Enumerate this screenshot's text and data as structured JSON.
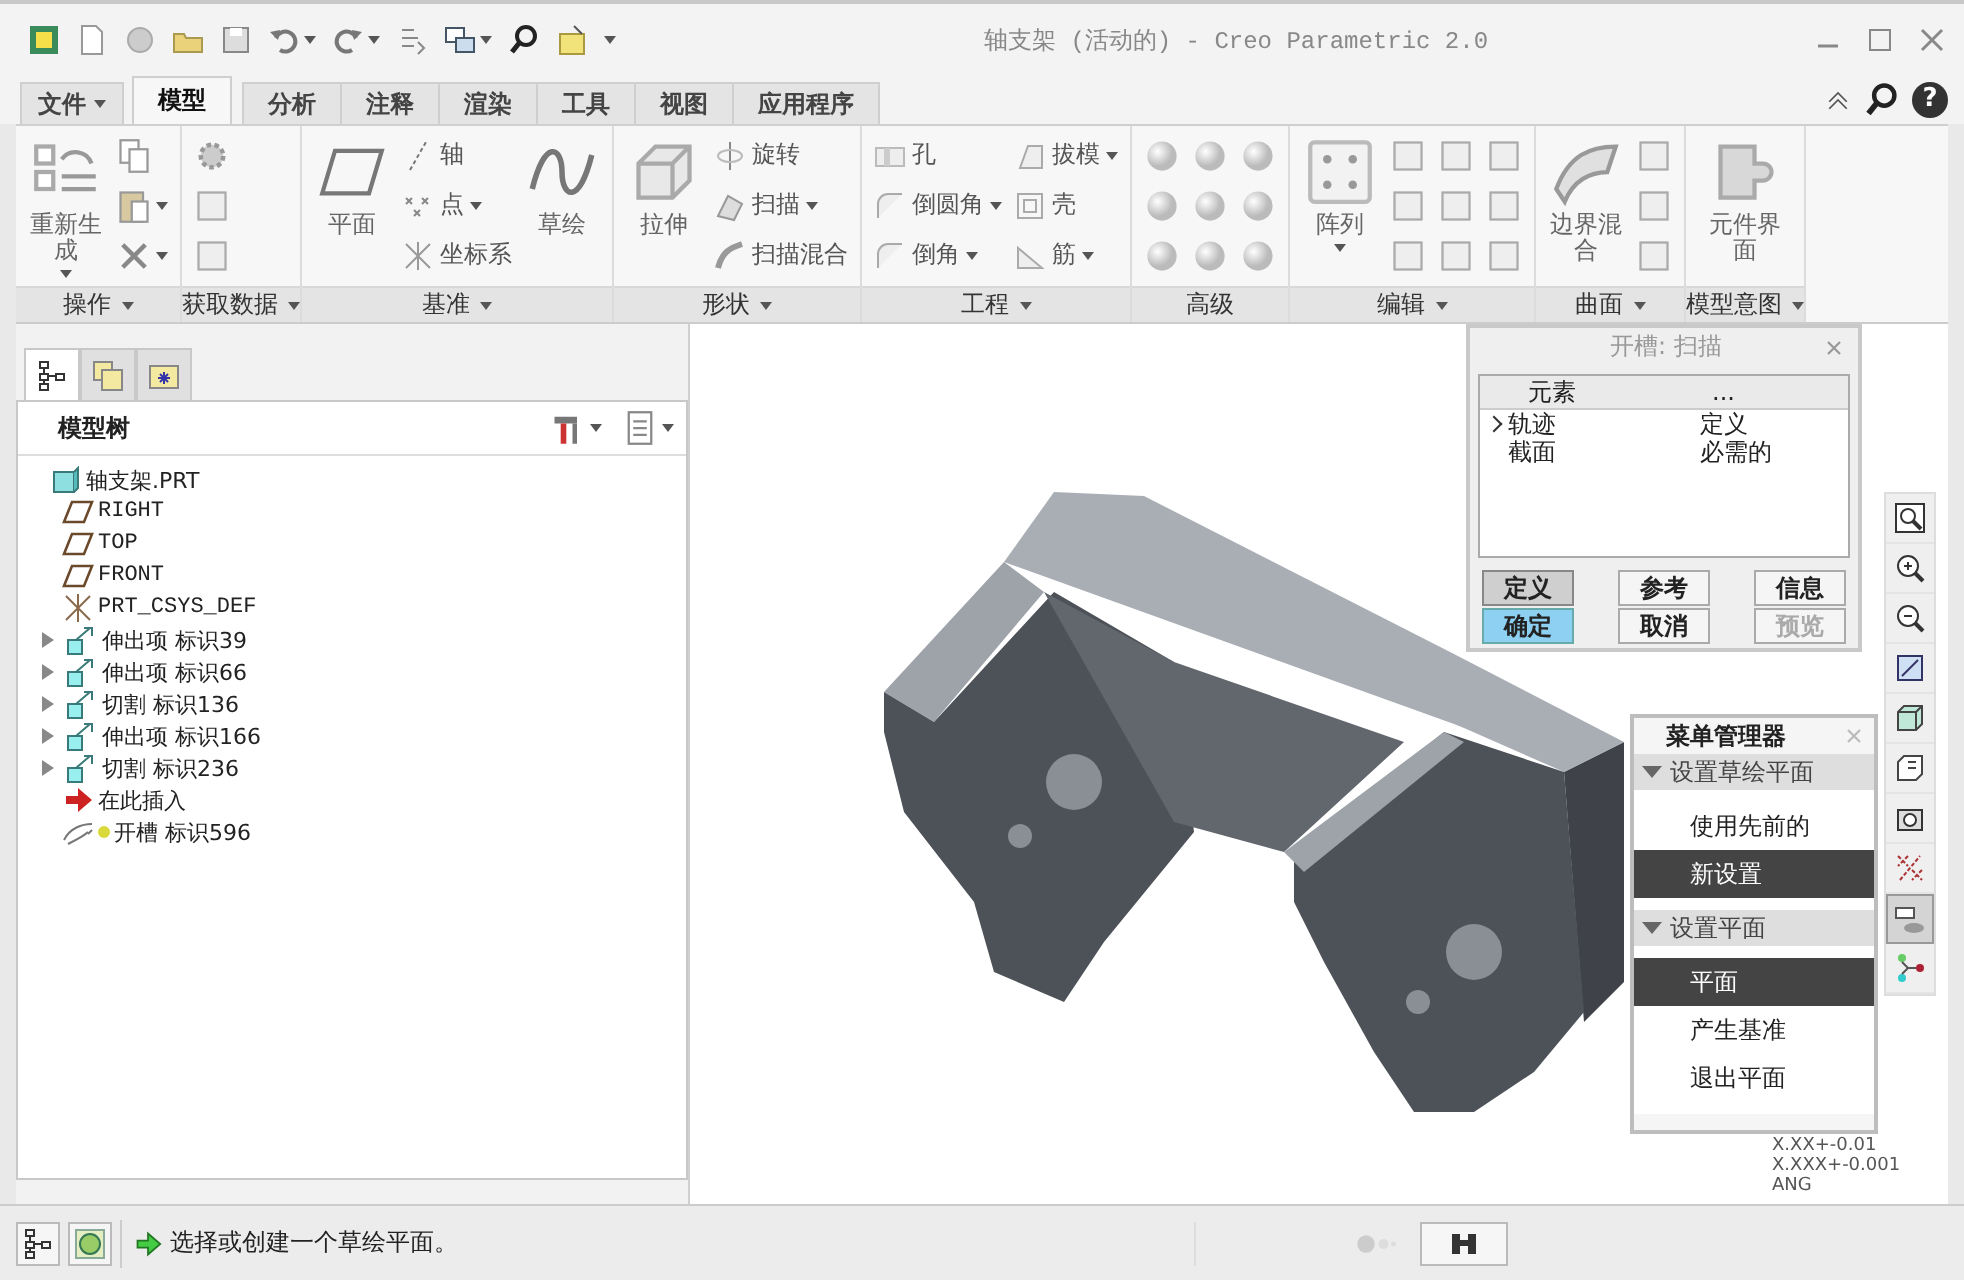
{
  "window": {
    "title": "轴支架 (活动的) - Creo Parametric 2.0"
  },
  "ribbon_tabs": [
    {
      "label": "文件",
      "kind": "menu",
      "selected": false
    },
    {
      "label": "模型",
      "kind": "tab",
      "selected": true
    },
    {
      "label": "分析",
      "kind": "tab",
      "selected": false
    },
    {
      "label": "注释",
      "kind": "tab",
      "selected": false
    },
    {
      "label": "渲染",
      "kind": "tab",
      "selected": false
    },
    {
      "label": "工具",
      "kind": "tab",
      "selected": false
    },
    {
      "label": "视图",
      "kind": "tab",
      "selected": false
    },
    {
      "label": "应用程序",
      "kind": "tab",
      "selected": false
    }
  ],
  "help_button": {
    "label": "?"
  },
  "ribbon_groups": [
    {
      "label": "操作",
      "dropdown": true,
      "items": [
        {
          "kind": "large",
          "label": "重新生成",
          "dropdown": true
        },
        {
          "kind": "icon",
          "dropdown": false
        },
        {
          "kind": "icon",
          "dropdown": true
        },
        {
          "kind": "icon",
          "dropdown": true
        }
      ]
    },
    {
      "label": "获取数据",
      "dropdown": true,
      "items": [
        {
          "kind": "icon",
          "dropdown": false
        },
        {
          "kind": "icon",
          "dropdown": false
        },
        {
          "kind": "icon",
          "dropdown": false
        }
      ]
    },
    {
      "label": "基准",
      "dropdown": true,
      "items": [
        {
          "kind": "large",
          "label": "平面",
          "dropdown": false
        },
        {
          "kind": "small",
          "label": "轴",
          "dropdown": false
        },
        {
          "kind": "small",
          "label": "点",
          "dropdown": true
        },
        {
          "kind": "small",
          "label": "坐标系",
          "dropdown": false
        },
        {
          "kind": "large",
          "label": "草绘",
          "dropdown": false
        }
      ]
    },
    {
      "label": "形状",
      "dropdown": true,
      "items": [
        {
          "kind": "large",
          "label": "拉伸",
          "dropdown": false
        },
        {
          "kind": "small",
          "label": "旋转",
          "dropdown": false
        },
        {
          "kind": "small",
          "label": "扫描",
          "dropdown": true
        },
        {
          "kind": "small",
          "label": "扫描混合",
          "dropdown": false
        }
      ]
    },
    {
      "label": "工程",
      "dropdown": true,
      "items": [
        {
          "kind": "small",
          "label": "孔",
          "dropdown": false
        },
        {
          "kind": "small",
          "label": "倒圆角",
          "dropdown": true
        },
        {
          "kind": "small",
          "label": "倒角",
          "dropdown": true
        },
        {
          "kind": "small",
          "label": "拔模",
          "dropdown": true
        },
        {
          "kind": "small",
          "label": "壳",
          "dropdown": false
        },
        {
          "kind": "small",
          "label": "筋",
          "dropdown": true
        }
      ]
    },
    {
      "label": "高级",
      "dropdown": false,
      "items": [
        {
          "kind": "icon",
          "dropdown": false
        },
        {
          "kind": "icon",
          "dropdown": false
        },
        {
          "kind": "icon",
          "dropdown": false
        },
        {
          "kind": "icon",
          "dropdown": false
        },
        {
          "kind": "icon",
          "dropdown": false
        },
        {
          "kind": "icon",
          "dropdown": false
        },
        {
          "kind": "icon",
          "dropdown": false
        },
        {
          "kind": "icon",
          "dropdown": false
        },
        {
          "kind": "icon",
          "dropdown": false
        }
      ]
    },
    {
      "label": "编辑",
      "dropdown": true,
      "items": [
        {
          "kind": "large",
          "label": "阵列",
          "dropdown": true
        },
        {
          "kind": "icon",
          "dropdown": false
        },
        {
          "kind": "icon",
          "dropdown": false
        },
        {
          "kind": "icon",
          "dropdown": false
        },
        {
          "kind": "icon",
          "dropdown": false
        },
        {
          "kind": "icon",
          "dropdown": false
        },
        {
          "kind": "icon",
          "dropdown": false
        },
        {
          "kind": "icon",
          "dropdown": false
        },
        {
          "kind": "icon",
          "dropdown": false
        },
        {
          "kind": "icon",
          "dropdown": false
        }
      ]
    },
    {
      "label": "曲面",
      "dropdown": true,
      "items": [
        {
          "kind": "large",
          "label": "边界混合",
          "dropdown": false
        },
        {
          "kind": "icon",
          "dropdown": false
        },
        {
          "kind": "icon",
          "dropdown": false
        },
        {
          "kind": "icon",
          "dropdown": false
        }
      ]
    },
    {
      "label": "模型意图",
      "dropdown": true,
      "items": [
        {
          "kind": "large",
          "label": "元件界面",
          "dropdown": false
        }
      ]
    }
  ],
  "model_tree": {
    "tabs": [
      {
        "selected": true
      },
      {
        "selected": false
      },
      {
        "selected": false
      }
    ],
    "title": "模型树",
    "items": [
      {
        "label": "轴支架.PRT",
        "kind": "part",
        "children": [
          {
            "label": "RIGHT",
            "kind": "plane"
          },
          {
            "label": "TOP",
            "kind": "plane"
          },
          {
            "label": "FRONT",
            "kind": "plane"
          },
          {
            "label": "PRT_CSYS_DEF",
            "kind": "csys"
          },
          {
            "label": "伸出项 标识39",
            "kind": "feature",
            "expanded": false
          },
          {
            "label": "伸出项 标识66",
            "kind": "feature",
            "expanded": false
          },
          {
            "label": "切割 标识136",
            "kind": "feature",
            "expanded": false
          },
          {
            "label": "伸出项 标识166",
            "kind": "feature",
            "expanded": false
          },
          {
            "label": "切割 标识236",
            "kind": "feature",
            "expanded": false
          },
          {
            "label": "在此插入",
            "kind": "insert"
          },
          {
            "label": "开槽 标识596",
            "kind": "new-feature"
          }
        ]
      }
    ]
  },
  "dialog": {
    "title": "开槽: 扫描",
    "columns": [
      "元素",
      "..."
    ],
    "rows": [
      {
        "element": "轨迹",
        "info": "定义",
        "current": true
      },
      {
        "element": "截面",
        "info": "必需的",
        "current": false
      }
    ],
    "buttons": [
      {
        "label": "定义",
        "kind": "pressed",
        "disabled": false
      },
      {
        "label": "参考",
        "kind": "normal",
        "disabled": false
      },
      {
        "label": "信息",
        "kind": "normal",
        "disabled": false
      },
      {
        "label": "确定",
        "kind": "primary",
        "disabled": false
      },
      {
        "label": "取消",
        "kind": "normal",
        "disabled": false
      },
      {
        "label": "预览",
        "kind": "normal",
        "disabled": true
      }
    ]
  },
  "menu_manager": {
    "title": "菜单管理器",
    "sections": [
      {
        "heading": "设置草绘平面",
        "expanded": true,
        "items": [
          {
            "label": "使用先前的",
            "selected": false
          },
          {
            "label": "新设置",
            "selected": true
          }
        ]
      },
      {
        "heading": "设置平面",
        "expanded": true,
        "items": [
          {
            "label": "平面",
            "selected": true
          },
          {
            "label": "产生基准",
            "selected": false
          },
          {
            "label": "退出平面",
            "selected": false
          }
        ]
      }
    ]
  },
  "view_toolbar": {
    "buttons": [
      {
        "selected": false
      },
      {
        "selected": false
      },
      {
        "selected": false
      },
      {
        "selected": false
      },
      {
        "selected": false
      },
      {
        "selected": false
      },
      {
        "selected": false
      },
      {
        "selected": false
      },
      {
        "selected": true
      },
      {
        "selected": false
      }
    ]
  },
  "tolerance_note": [
    "X.XX+-0.01",
    "X.XXX+-0.001",
    "ANG"
  ],
  "status_bar": {
    "message": "选择或创建一个草绘平面。"
  }
}
